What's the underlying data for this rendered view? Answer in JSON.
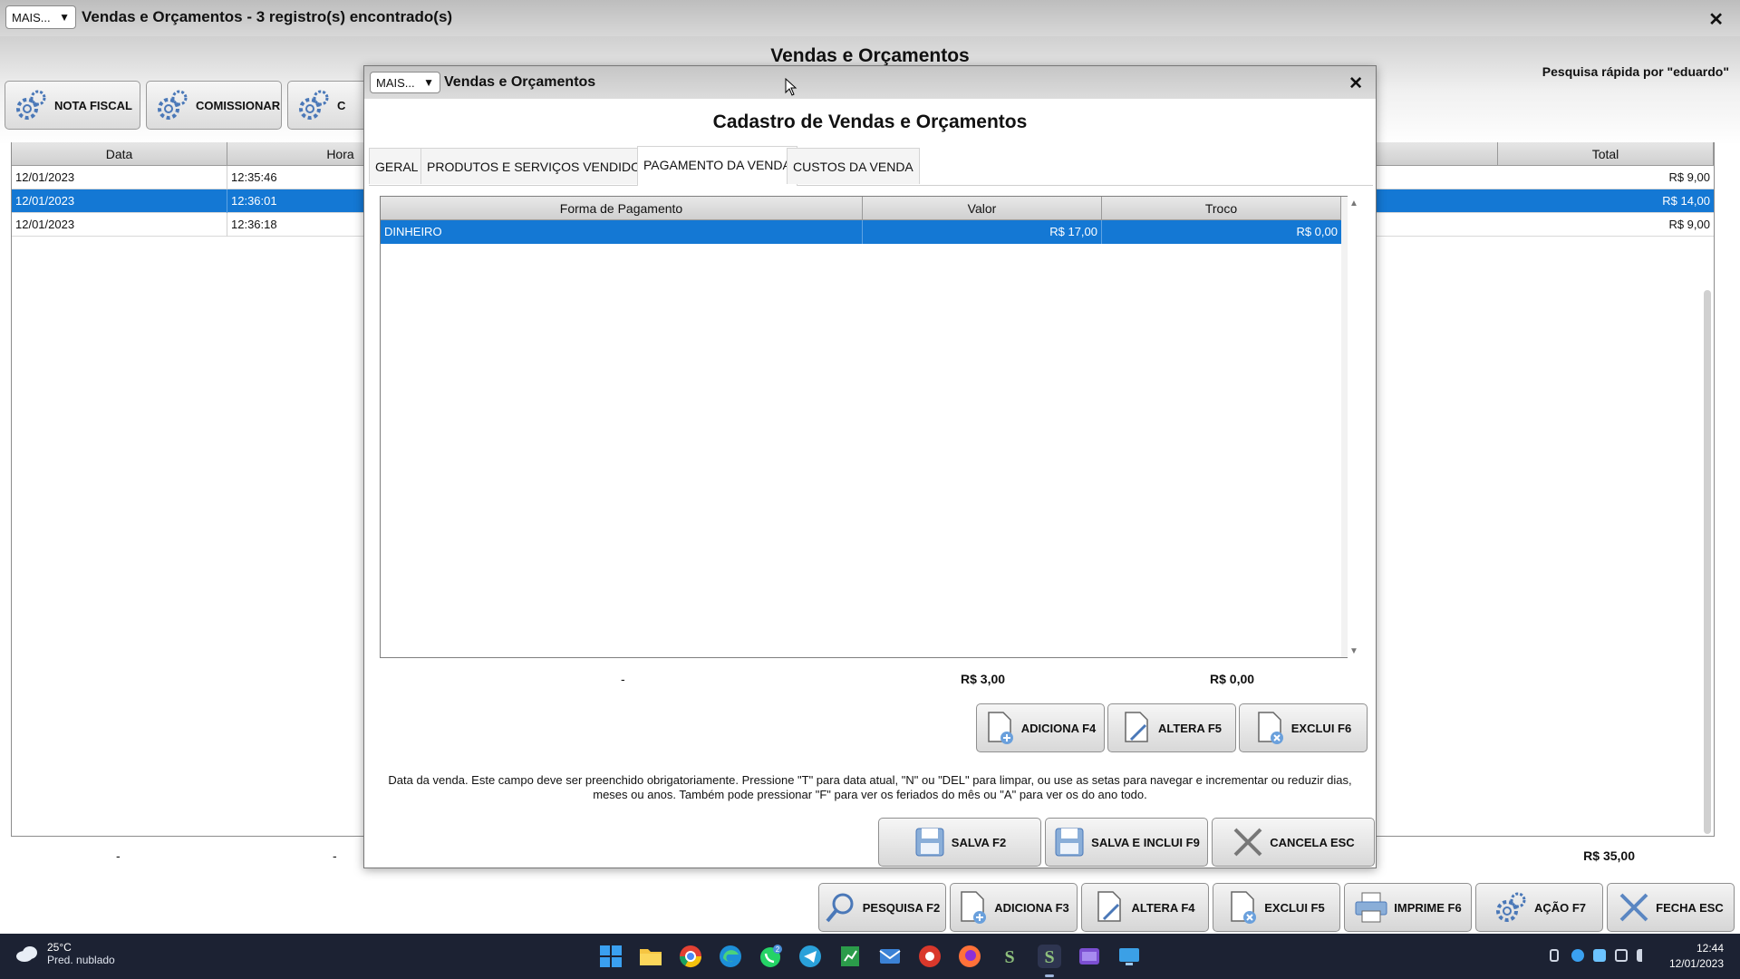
{
  "outer": {
    "mais_label": "MAIS...",
    "title": "Vendas e Orçamentos - 3 registro(s) encontrado(s)",
    "close_glyph": "✕",
    "heading": "Vendas e Orçamentos",
    "quick_search": "Pesquisa rápida por \"eduardo\"",
    "toolbar": {
      "nota_fiscal": "NOTA FISCAL",
      "comissionar": "COMISSIONAR",
      "third": "C"
    },
    "grid": {
      "headers": {
        "data": "Data",
        "hora": "Hora",
        "total": "Total"
      },
      "rows": [
        {
          "data": "12/01/2023",
          "hora": "12:35:46",
          "total": "R$ 9,00",
          "selected": false
        },
        {
          "data": "12/01/2023",
          "hora": "12:36:01",
          "total": "R$ 14,00",
          "selected": true
        },
        {
          "data": "12/01/2023",
          "hora": "12:36:18",
          "total": "R$ 9,00",
          "selected": false
        }
      ]
    },
    "footer": {
      "dash1": "-",
      "dash2": "-",
      "total": "R$ 35,00"
    },
    "actions": {
      "pesquisa": "PESQUISA F2",
      "adiciona": "ADICIONA F3",
      "altera": "ALTERA F4",
      "exclui": "EXCLUI F5",
      "imprime": "IMPRIME F6",
      "acao": "AÇÃO F7",
      "fecha": "FECHA ESC"
    }
  },
  "modal": {
    "mais_label": "MAIS...",
    "title": "Vendas e Orçamentos",
    "close_glyph": "✕",
    "heading": "Cadastro de Vendas e Orçamentos",
    "tabs": {
      "geral": "GERAL",
      "produtos": "PRODUTOS E SERVIÇOS VENDIDOS",
      "pagamento": "PAGAMENTO DA VENDA",
      "custos": "CUSTOS DA VENDA"
    },
    "payments": {
      "headers": {
        "forma": "Forma de Pagamento",
        "valor": "Valor",
        "troco": "Troco"
      },
      "row": {
        "forma": "DINHEIRO",
        "valor": "R$ 17,00",
        "troco": "R$ 0,00"
      },
      "summary": {
        "dash": "-",
        "valor": "R$ 3,00",
        "troco": "R$ 0,00"
      }
    },
    "sub_buttons": {
      "adiciona": "ADICIONA F4",
      "altera": "ALTERA F5",
      "exclui": "EXCLUI F6"
    },
    "hint": "Data da venda. Este campo deve ser preenchido obrigatoriamente. Pressione \"T\" para data atual, \"N\" ou \"DEL\" para limpar, ou use as setas para navegar e incrementar ou reduzir dias, meses ou anos. Também pode pressionar \"F\" para ver os feriados do mês ou \"A\" para ver os do ano todo.",
    "dialog_buttons": {
      "salva": "SALVA F2",
      "salva_inclui": "SALVA E INCLUI F9",
      "cancela": "CANCELA ESC"
    }
  },
  "taskbar": {
    "weather_temp": "25°C",
    "weather_desc": "Pred. nublado",
    "whatsapp_badge": "2",
    "time": "12:44",
    "date": "12/01/2023"
  },
  "colors": {
    "selection": "#1478d4",
    "taskbar": "#1c2233"
  }
}
